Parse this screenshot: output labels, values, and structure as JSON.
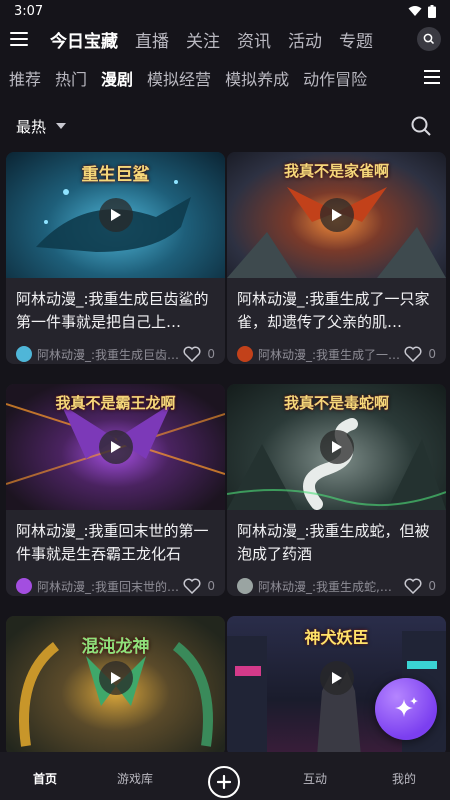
{
  "status_bar": {
    "time": "3:07"
  },
  "top_nav": {
    "tabs": [
      {
        "label": "今日宝藏",
        "active": true
      },
      {
        "label": "直播"
      },
      {
        "label": "关注"
      },
      {
        "label": "资讯"
      },
      {
        "label": "活动"
      },
      {
        "label": "专题"
      }
    ]
  },
  "category_nav": {
    "tabs": [
      {
        "label": "推荐"
      },
      {
        "label": "热门"
      },
      {
        "label": "漫剧",
        "active": true
      },
      {
        "label": "模拟经营"
      },
      {
        "label": "模拟养成"
      },
      {
        "label": "动作冒险"
      }
    ]
  },
  "filter": {
    "sort_label": "最热"
  },
  "cards": [
    {
      "thumb_text": "重生巨鲨",
      "title": "阿林动漫_:我重生成巨齿鲨的第一件事就是把自己上…",
      "author": "阿林动漫_:我重生成巨齿…",
      "likes": "0",
      "bg": "#1e5f7a",
      "accent": "#4fb6d8"
    },
    {
      "thumb_text": "我真不是家雀啊",
      "title": "阿林动漫_:我重生成了一只家雀，却遗传了父亲的肌…",
      "author": "阿林动漫_:我重生成了一…",
      "likes": "0",
      "bg": "#3b3f52",
      "accent": "#e0541f"
    },
    {
      "thumb_text": "我真不是霸王龙啊",
      "title": "阿林动漫_:我重回末世的第一件事就是生吞霸王龙化石",
      "author": "阿林动漫_:我重回末世的…",
      "likes": "0",
      "bg": "#2a1f33",
      "accent": "#a34ee0"
    },
    {
      "thumb_text": "我真不是毒蛇啊",
      "title": "阿林动漫_:我重生成蛇，但被泡成了药酒",
      "author": "阿林动漫_:我重生成蛇,…",
      "likes": "0",
      "bg": "#2b3a38",
      "accent": "#cfd8d6"
    },
    {
      "thumb_text": "混沌龙神",
      "title": "",
      "author": "",
      "likes": "",
      "bg": "#2f3a2a",
      "accent": "#d8a53a"
    },
    {
      "thumb_text": "神犬妖臣",
      "title": "",
      "author": "",
      "likes": "",
      "bg": "#1d2033",
      "accent": "#d43a8a"
    }
  ],
  "bottom_nav": {
    "items": [
      {
        "label": "首页",
        "active": true
      },
      {
        "label": "游戏库"
      },
      {
        "label": "互动"
      },
      {
        "label": "我的"
      }
    ]
  },
  "colors": {
    "background": "#15141a",
    "card": "#25242c",
    "fab": "#8a4cf2",
    "muted_text": "#8e8d96"
  }
}
